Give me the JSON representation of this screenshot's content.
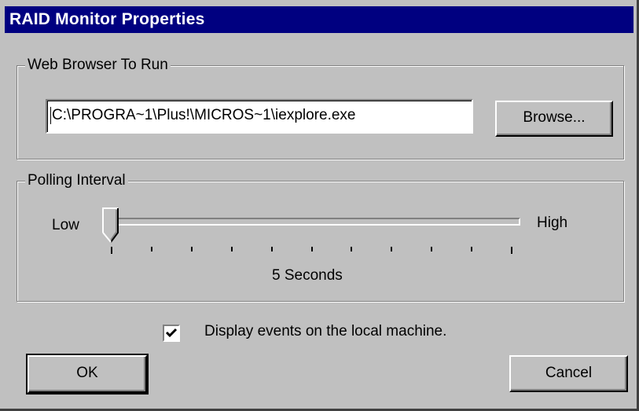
{
  "window": {
    "title": "RAID Monitor Properties"
  },
  "web_browser_group": {
    "label": "Web Browser To Run",
    "path_value": "C:\\PROGRA~1\\Plus!\\MICROS~1\\iexplore.exe",
    "browse_label": "Browse..."
  },
  "polling_group": {
    "label": "Polling Interval",
    "low_label": "Low",
    "high_label": "High",
    "value_text": "5 Seconds",
    "slider_value_fraction": 0,
    "tick_count": 11
  },
  "display_events": {
    "label": "Display events on the local machine.",
    "checked": true
  },
  "buttons": {
    "ok_label": "OK",
    "cancel_label": "Cancel"
  },
  "colors": {
    "titlebar": "#000080",
    "face": "#c0c0c0",
    "shadow": "#808080",
    "highlight": "#ffffff"
  }
}
